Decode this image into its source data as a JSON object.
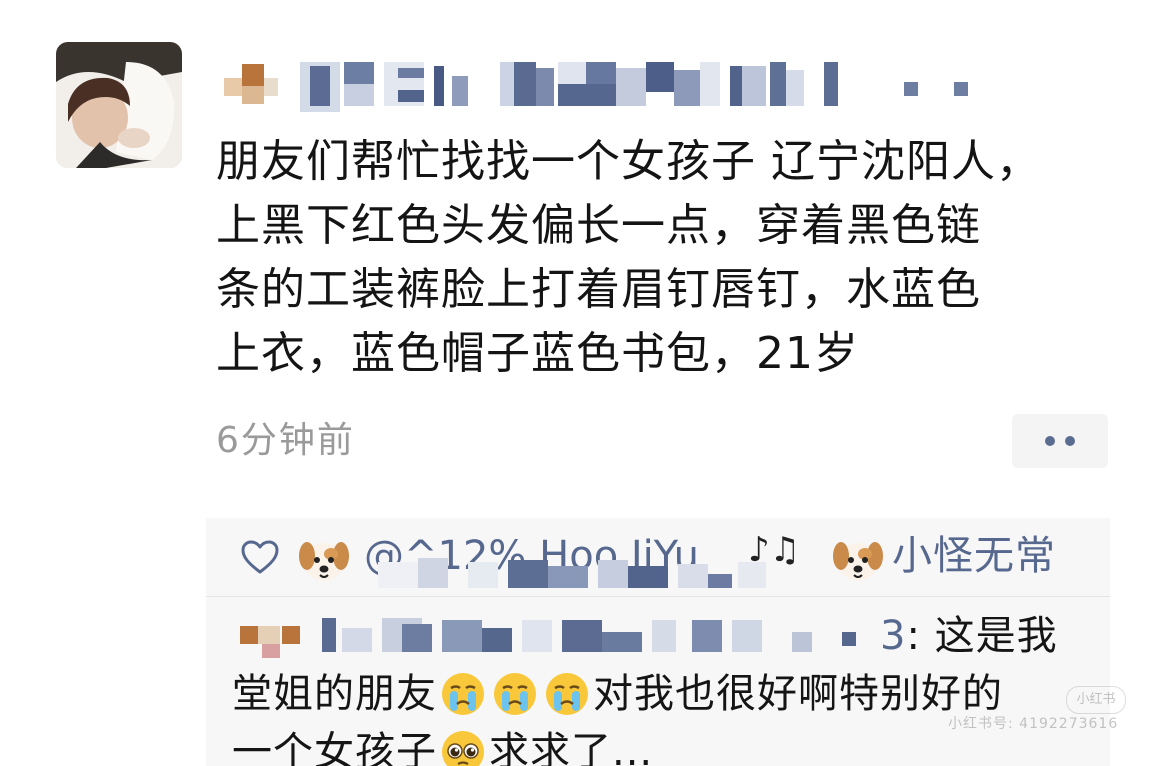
{
  "post": {
    "author_name": "",
    "text": "朋友们帮忙找找一个女孩子 辽宁沈阳人，\n上黑下红色头发偏长一点，穿着黑色链\n条的工装裤脸上打着眉钉唇钉，水蓝色\n上衣，蓝色帽子蓝色书包，21岁",
    "time": "6分钟前"
  },
  "likes": {
    "liker1": "@^12% Hoo JiYu",
    "liker1_suffix": "♪♫",
    "liker2": "小怪无常"
  },
  "comment": {
    "author_tail": "3",
    "line1": ": 这是我",
    "line2a": "堂姐的朋友",
    "line2b": "对我也很好啊特别好的",
    "line3a": "一个女孩子",
    "line3b": "求求了..."
  },
  "watermark": {
    "badge": "小红书",
    "id": "小红书号: 4192273616"
  },
  "colors": {
    "link": "#57688f",
    "text": "#141414",
    "muted": "#9a9a9a",
    "panel": "#f7f7f7"
  }
}
